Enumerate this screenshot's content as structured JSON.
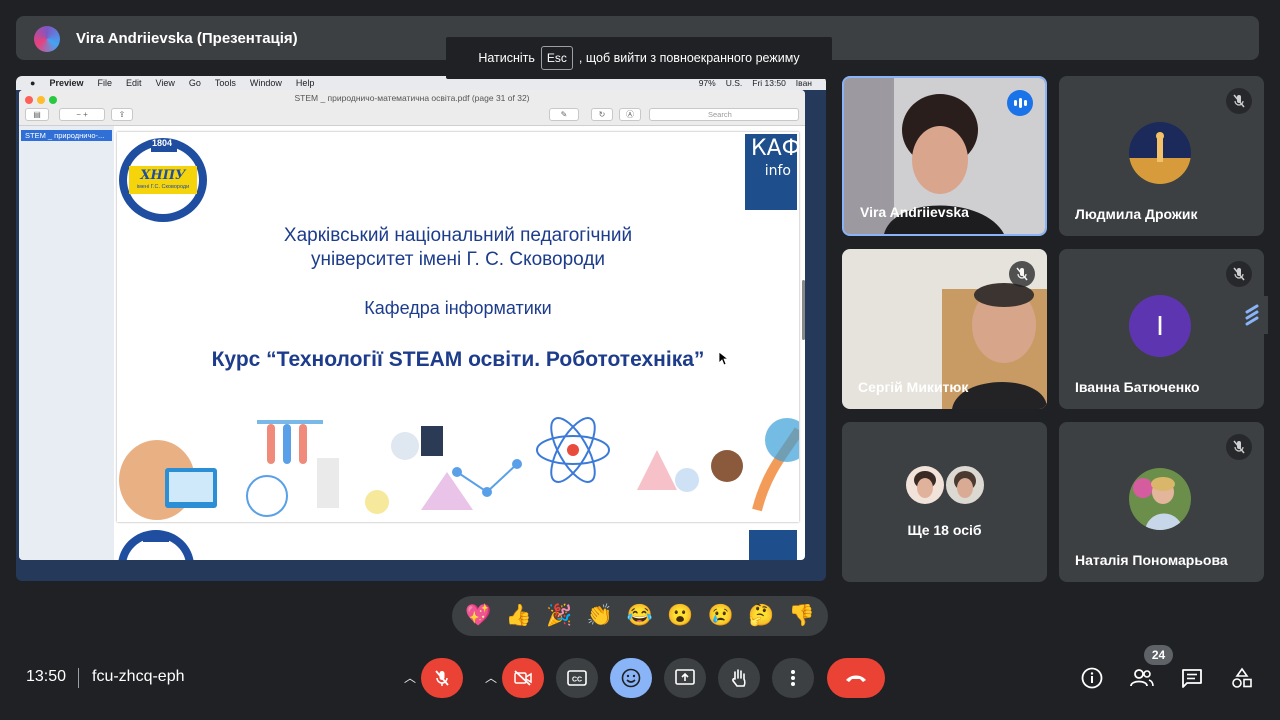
{
  "top_bar": {
    "presenter_label": "Vira Andriievska (Презентація)"
  },
  "fullscreen_toast": {
    "prefix": "Натисніть",
    "key": "Esc",
    "suffix": ", щоб вийти з повноекранного режиму"
  },
  "shared_screen": {
    "mac_menu": [
      "Preview",
      "File",
      "Edit",
      "View",
      "Go",
      "Tools",
      "Window",
      "Help"
    ],
    "mac_status": {
      "battery": "97%",
      "locale": "U.S.",
      "time": "Fri 13:50",
      "user": "Іван"
    },
    "window_title": "STEM _ природничо-математична освіта.pdf (page 31 of 32)",
    "search_placeholder": "Search",
    "sidebar_item": "STEM _ природничо-...",
    "slide": {
      "seal_year": "1804",
      "seal_text": "ХНПУ",
      "seal_sub": "імені Г.С. Сковороди",
      "kaf_logo_top": "КАФ",
      "kaf_logo_bottom": "info",
      "university_line1": "Харківський національний педагогічний",
      "university_line2": "університет імені Г. С. Сковороди",
      "department": "Кафедра інформатики",
      "course": "Курс “Технології STEAM освіти. Робототехніка”"
    }
  },
  "participants": [
    {
      "name": "Vira Andriievska",
      "state": "speaking"
    },
    {
      "name": "Людмила Дрожик",
      "state": "muted"
    },
    {
      "name": "Сергій Микитюк",
      "state": "muted"
    },
    {
      "name": "Іванна Батюченко",
      "state": "muted",
      "initial": "І",
      "color": "#5e35b1"
    },
    {
      "name": "Ще 18 осіб",
      "state": "group"
    },
    {
      "name": "Наталія Пономарьова",
      "state": "muted"
    }
  ],
  "reactions": [
    "💖",
    "👍",
    "🎉",
    "👏",
    "😂",
    "😮",
    "😢",
    "🤔",
    "👎"
  ],
  "bottom_bar": {
    "time": "13:50",
    "meeting_code": "fcu-zhcq-eph",
    "people_count": "24"
  },
  "colors": {
    "background": "#202124",
    "surface": "#3c4043",
    "danger": "#ea4335",
    "accent": "#8ab4f8",
    "slide_text": "#1d3c8c"
  }
}
